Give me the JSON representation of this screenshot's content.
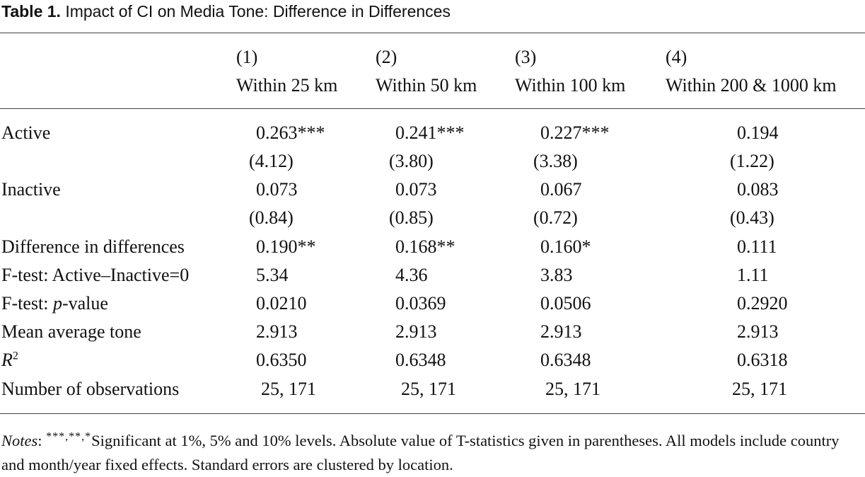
{
  "title": {
    "label": "Table 1.",
    "text": "Impact of CI on Media Tone: Difference in Differences"
  },
  "columns": [
    {
      "number": "(1)",
      "heading": "Within 25 km"
    },
    {
      "number": "(2)",
      "heading": "Within 50 km"
    },
    {
      "number": "(3)",
      "heading": "Within 100 km"
    },
    {
      "number": "(4)",
      "heading": "Within 200 & 1000 km"
    }
  ],
  "rows": [
    {
      "label": "Active",
      "values": [
        "0.263***",
        "0.241***",
        "0.227***",
        "0.194"
      ]
    },
    {
      "label": "",
      "values": [
        "(4.12)",
        "(3.80)",
        "(3.38)",
        "(1.22)"
      ]
    },
    {
      "label": "Inactive",
      "values": [
        "0.073",
        "0.073",
        "0.067",
        "0.083"
      ]
    },
    {
      "label": "",
      "values": [
        "(0.84)",
        "(0.85)",
        "(0.72)",
        "(0.43)"
      ]
    },
    {
      "label": "Difference in differences",
      "values": [
        "0.190**",
        "0.168**",
        "0.160*",
        "0.111"
      ]
    },
    {
      "label": "F-test: Active–Inactive=0",
      "values": [
        "5.34",
        "4.36",
        "3.83",
        "1.11"
      ]
    },
    {
      "label_pre": "F-test: ",
      "label_italic": "p",
      "label_post": "-value",
      "values": [
        "0.0210",
        "0.0369",
        "0.0506",
        "0.2920"
      ]
    },
    {
      "label": "Mean average tone",
      "values": [
        "2.913",
        "2.913",
        "2.913",
        "2.913"
      ]
    },
    {
      "label_italic": "R",
      "label_sup": "2",
      "values": [
        "0.6350",
        "0.6348",
        "0.6348",
        "0.6318"
      ]
    },
    {
      "label": "Number of observations",
      "values": [
        "25, 171",
        "25, 171",
        "25, 171",
        "25, 171"
      ]
    }
  ],
  "notes": {
    "prefix": "Notes",
    "colon": ": ",
    "stars": "***,**,*",
    "text": "Significant at 1%, 5% and 10% levels. Absolute value of T-statistics given in parentheses. All models include country and month/year fixed effects. Standard errors are clustered by location."
  }
}
